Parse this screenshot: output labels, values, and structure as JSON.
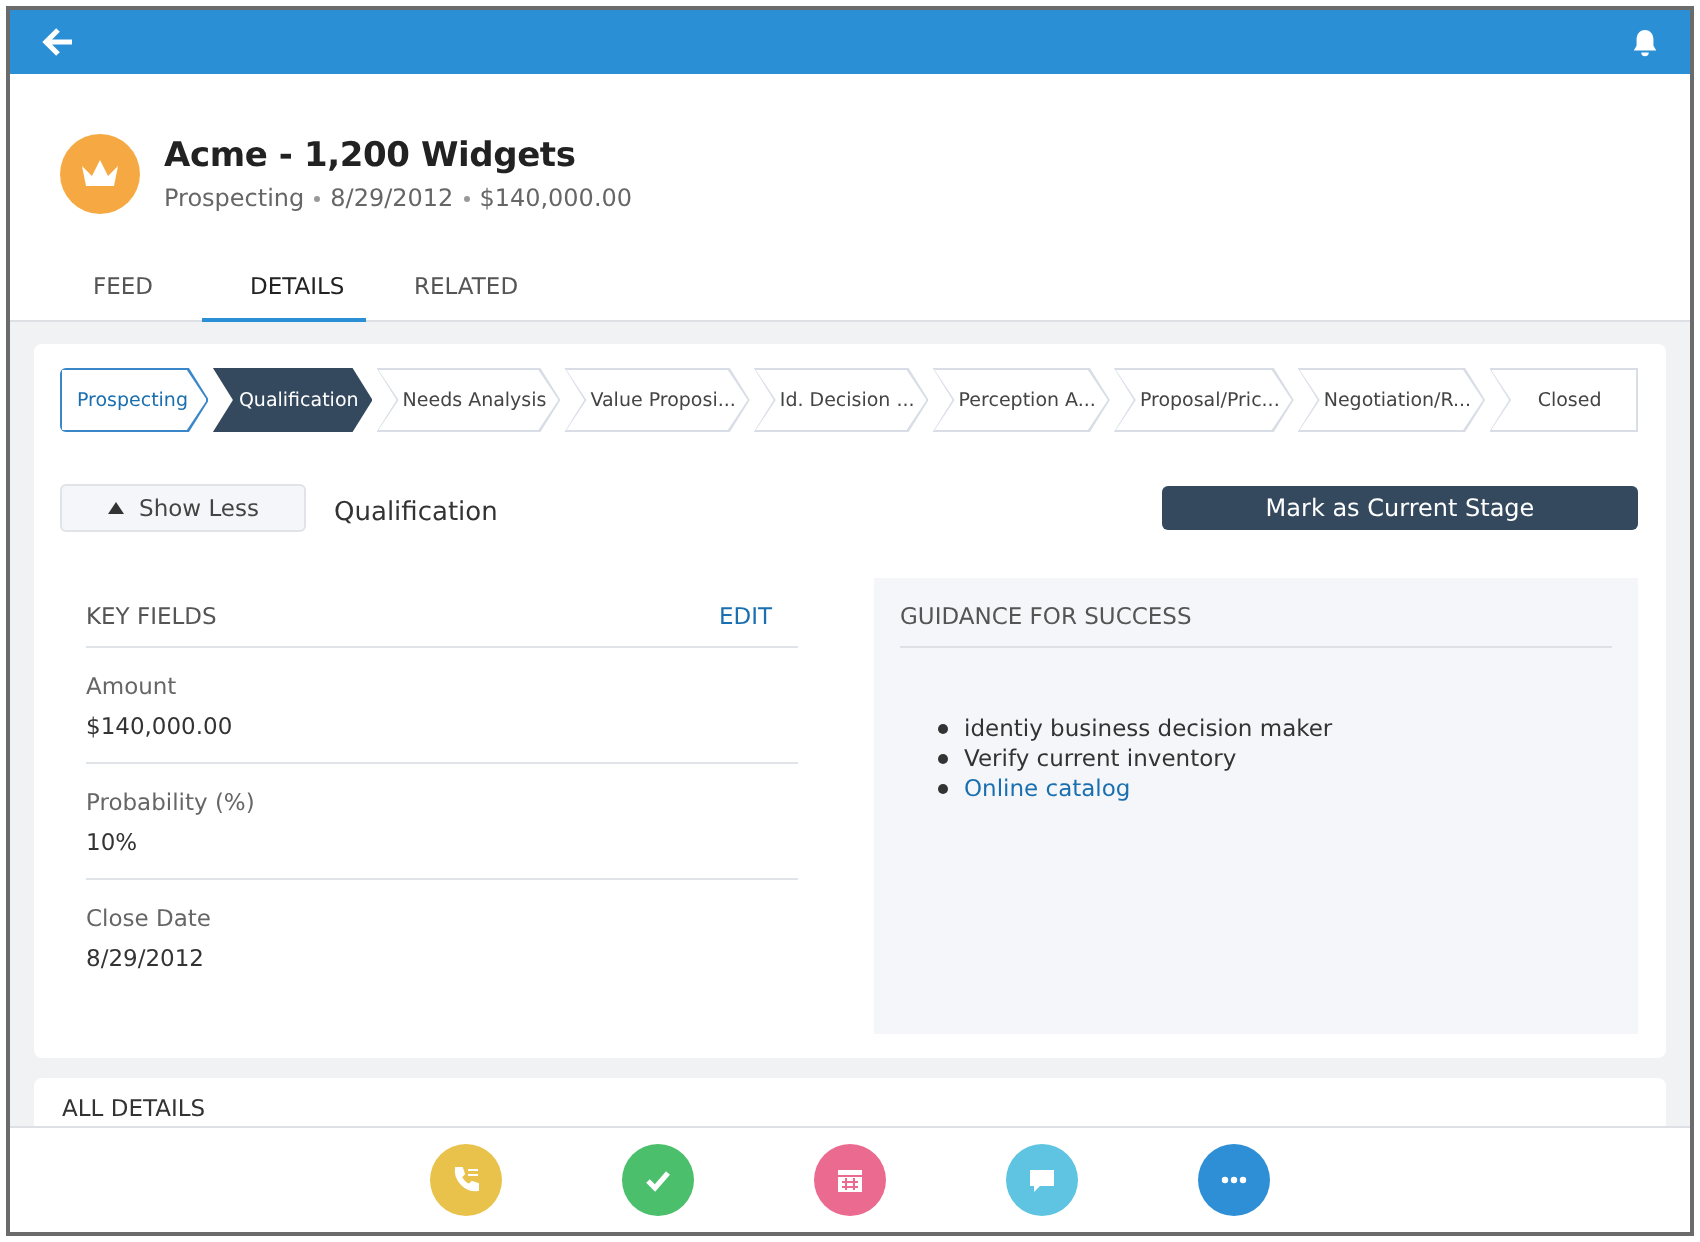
{
  "record": {
    "title": "Acme - 1,200 Widgets",
    "meta": [
      "Prospecting",
      "8/29/2012",
      "$140,000.00"
    ]
  },
  "tabs": [
    {
      "label": "FEED",
      "selected": false
    },
    {
      "label": "DETAILS",
      "selected": true
    },
    {
      "label": "RELATED",
      "selected": false
    }
  ],
  "path": [
    {
      "label": "Prospecting",
      "complete": true,
      "selected": false
    },
    {
      "label": "Qualification",
      "complete": false,
      "selected": true
    },
    {
      "label": "Needs Analysis",
      "complete": false,
      "selected": false
    },
    {
      "label": "Value Proposi...",
      "complete": false,
      "selected": false
    },
    {
      "label": "Id. Decision ...",
      "complete": false,
      "selected": false
    },
    {
      "label": "Perception A...",
      "complete": false,
      "selected": false
    },
    {
      "label": "Proposal/Pric...",
      "complete": false,
      "selected": false
    },
    {
      "label": "Negotiation/R...",
      "complete": false,
      "selected": false
    },
    {
      "label": "Closed",
      "complete": false,
      "selected": false
    }
  ],
  "toggle": {
    "label": "Show Less",
    "expanded": true
  },
  "stage_name": "Qualification",
  "mark_button": "Mark as Current Stage",
  "key_fields": {
    "heading": "KEY FIELDS",
    "edit": "EDIT",
    "fields": [
      {
        "label": "Amount",
        "value": "$140,000.00"
      },
      {
        "label": "Probability (%)",
        "value": "10%"
      },
      {
        "label": "Close Date",
        "value": "8/29/2012"
      }
    ]
  },
  "guidance": {
    "heading": "GUIDANCE FOR SUCCESS",
    "items": [
      {
        "text": "identiy business decision maker",
        "kind": "text"
      },
      {
        "text": "Verify current inventory",
        "kind": "text"
      },
      {
        "text": "Online catalog",
        "kind": "link"
      }
    ]
  },
  "all_details": "ALL DETAILS",
  "actions": [
    {
      "kind": "call",
      "color": "#e8c24a"
    },
    {
      "kind": "task",
      "color": "#4bbf6b"
    },
    {
      "kind": "event",
      "color": "#eb6a8f"
    },
    {
      "kind": "post",
      "color": "#5ec4e2"
    },
    {
      "kind": "more",
      "color": "#2e8fd6"
    }
  ]
}
